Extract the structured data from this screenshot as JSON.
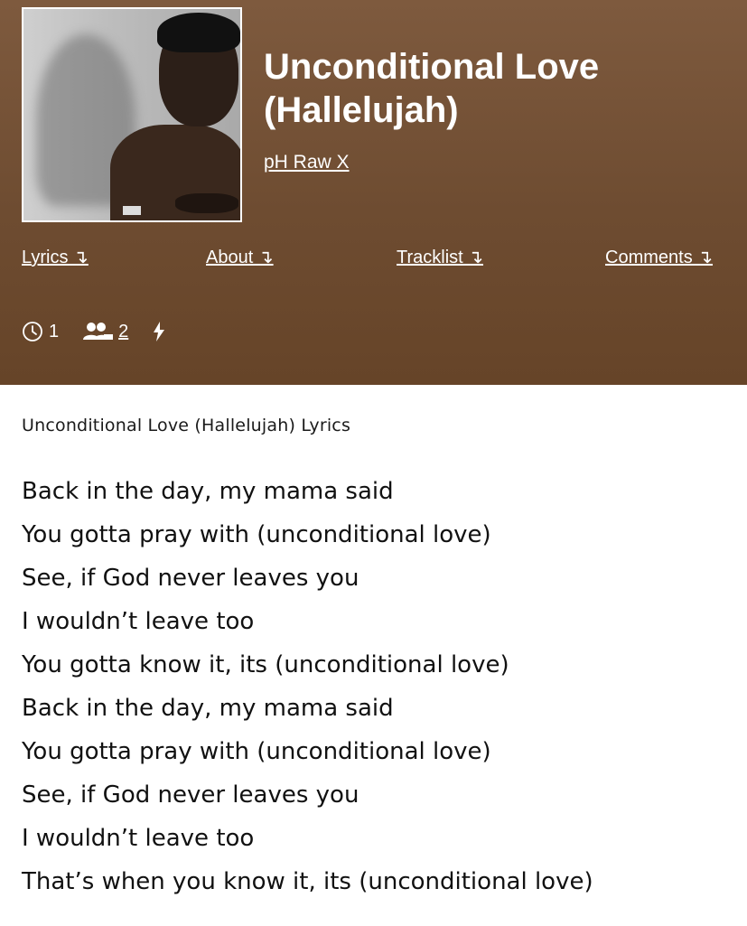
{
  "song": {
    "title": "Unconditional Love (Hallelujah)",
    "artist": "pH Raw X"
  },
  "nav": {
    "lyrics": "Lyrics ↴",
    "about": "About ↴",
    "tracklist": "Tracklist ↴",
    "comments": "Comments ↴"
  },
  "stats": {
    "views_count": "1",
    "contributors_count": "2"
  },
  "lyrics_section": {
    "heading": "Unconditional Love (Hallelujah) Lyrics",
    "lines": [
      "Back in the day, my mama said",
      "You gotta pray with (unconditional love)",
      "See, if God never leaves you",
      "I wouldn’t leave too",
      "You gotta know it, its (unconditional love)",
      "Back in the day, my mama said",
      "You gotta pray with (unconditional love)",
      "See, if God never leaves you",
      "I wouldn’t leave too",
      "That’s when you know it, its (unconditional love)"
    ]
  },
  "colors": {
    "header_background": "#6e4c31",
    "header_text": "#ffffff",
    "page_background": "#ffffff"
  }
}
